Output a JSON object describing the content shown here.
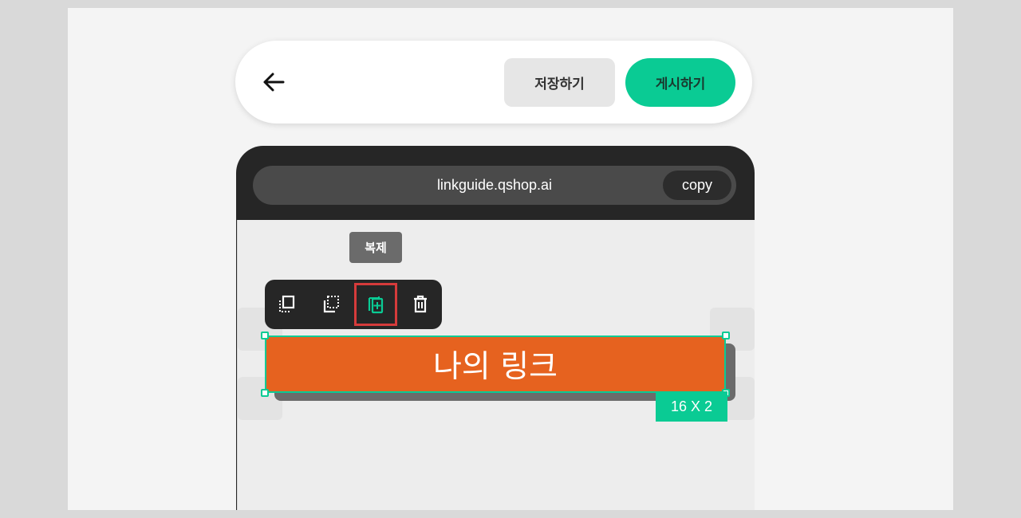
{
  "header": {
    "back_icon": "arrow-left-icon",
    "save_label": "저장하기",
    "publish_label": "게시하기"
  },
  "urlbar": {
    "url": "linkguide.qshop.ai",
    "copy_label": "copy"
  },
  "tooltip": {
    "text": "복제"
  },
  "toolbar": {
    "tools": [
      {
        "icon": "bring-forward-icon",
        "selected": false
      },
      {
        "icon": "send-backward-icon",
        "selected": false
      },
      {
        "icon": "duplicate-icon",
        "selected": true
      },
      {
        "icon": "trash-icon",
        "selected": false
      }
    ]
  },
  "block": {
    "label": "나의 링크",
    "size_badge": "16 X 2"
  },
  "colors": {
    "accent": "#0acb94",
    "block": "#e6621f",
    "highlight": "#d63b3b",
    "dark": "#262626"
  }
}
